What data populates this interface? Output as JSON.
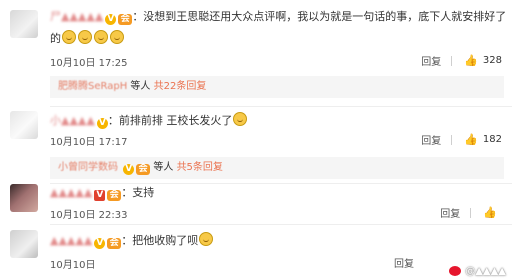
{
  "comments": [
    {
      "username": "尸▲▲▲▲▲",
      "text": "：没想到王思聪还用大众点评啊，我以为就是一句话的事，底下人就安排好了",
      "text_line2": "的",
      "time": "10月10日 17:25",
      "reply_label": "回复",
      "likes": "328",
      "replies": {
        "user": "肥腾腾SeRapH",
        "middle": "等人",
        "count": "共22条回复"
      }
    },
    {
      "username": "小▲▲▲▲",
      "text": "：前排前排 王校长发火了",
      "time": "10月10日 17:17",
      "reply_label": "回复",
      "likes": "182",
      "replies": {
        "user": "小曾同学数码",
        "middle": "等人",
        "count": "共5条回复"
      }
    },
    {
      "username": "▲▲▲▲▲",
      "text": "：支持",
      "time": "10月10日 22:33",
      "reply_label": "回复",
      "likes": ""
    },
    {
      "username": "▲▲▲▲▲",
      "text": "：把他收购了呗",
      "time": "10月10日",
      "reply_label": "回复",
      "likes": ""
    }
  ],
  "icons": {
    "verified_badge": "V",
    "thumb_icon": "👍"
  },
  "watermark": "@▲▲▲▲",
  "colors": {
    "username": "#e28a8a",
    "reply_count": "#eb7350",
    "badge": "#f7b500"
  }
}
